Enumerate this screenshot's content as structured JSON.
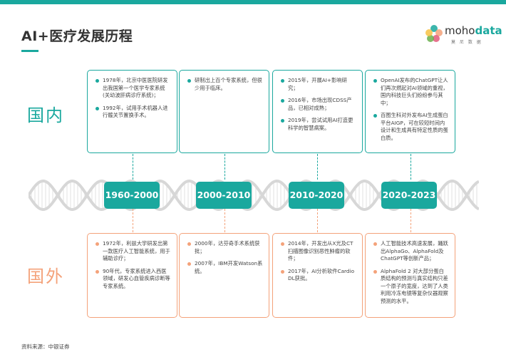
{
  "title": "AI+医疗发展历程",
  "logo": {
    "brand_prefix": "moho",
    "brand_suffix": "data",
    "subtitle": "莫 尼 数 据"
  },
  "labels": {
    "domestic": "国内",
    "international": "国外"
  },
  "periods": [
    "1960-2000",
    "2000-2010",
    "2010-2020",
    "2020-2023"
  ],
  "domestic": [
    [
      "1978年，北京中医医院研发出我国第一个医学专家系统(关幼波肝病诊疗系统)；",
      "1992年，试用手术机器人进行髋关节置换手术。"
    ],
    [
      "研制出上百个专家系统，但很少用于临床。"
    ],
    [
      "2015年，开展AI+影响研究；",
      "2016年，市场出现CDSS产品，已相对成熟；",
      "2019年，尝试试用AI打造更科学的智慧病案。"
    ],
    [
      "OpenAI发布的ChatGPT让人们再次燃起对AI领域的重视，国内科技巨头们纷纷参与其中；",
      "百图生科对外发布AI生成蛋白平台AIGP，可在较短时间内设计和生成具有特定性质的蛋白质。"
    ]
  ],
  "international": [
    [
      "1972年，利兹大学研发出第一款医疗人工智能系统，用于辅助诊疗；",
      "90年代，专家系统进入西医领域，研发心血管疾病诊断等专家系统。"
    ],
    [
      "2000年，达芬奇手术系统获批；",
      "2007年，IBM开发Watson系统。"
    ],
    [
      "2014年，开发出从X光及CT扫描图像识别恶性肿瘤的软件；",
      "2017年，AI分析软件Cardio DL获批。"
    ],
    [
      "人工智能技术高速发展，踊跃出AlphaGo、AlphaFold及ChatGPT等创新产品；",
      "AlphaFold 2 对大部分蛋白质结构的预测与真实结构只差一个原子的宽度，达到了人类利用冷冻电镜等复杂仪器观察预测的水平。"
    ]
  ],
  "source": "资料来源：中银证券",
  "colors": {
    "teal": "#1aa89e",
    "orange": "#f4a27a",
    "helix": "#d7d7d7"
  }
}
